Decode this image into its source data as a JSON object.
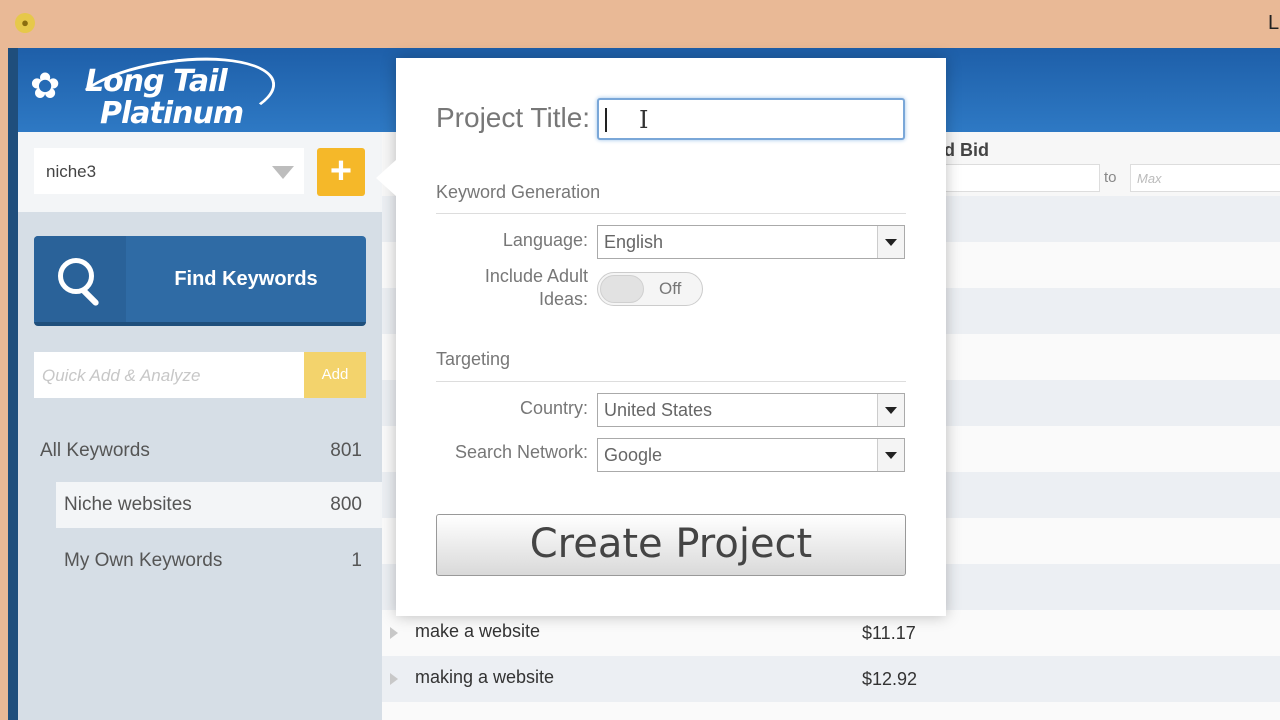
{
  "window": {
    "title_letter": "L",
    "app_icon": "app-icon"
  },
  "logo": {
    "line1": "Long Tail",
    "line2": "Platinum"
  },
  "sidebar": {
    "project_select": {
      "value": "niche3"
    },
    "add_project_icon": "+",
    "find_keywords_label": "Find Keywords",
    "quick_add": {
      "placeholder": "Quick Add & Analyze",
      "button_label": "Add"
    },
    "items": [
      {
        "label": "All Keywords",
        "count": "801"
      },
      {
        "label": "Niche websites",
        "count": "800"
      },
      {
        "label": "My Own Keywords",
        "count": "1"
      }
    ]
  },
  "table": {
    "bid_header": "d Bid",
    "range_to": "to",
    "range_max_placeholder": "Max",
    "rows": [
      {
        "keyword": "make a website",
        "bid": "$11.17"
      },
      {
        "keyword": "making a website",
        "bid": "$12.92"
      }
    ]
  },
  "dialog": {
    "project_title_label": "Project Title:",
    "project_title_value": "",
    "keyword_generation_heading": "Keyword Generation",
    "language_label": "Language:",
    "language_value": "English",
    "include_adult_label_1": "Include Adult",
    "include_adult_label_2": "Ideas:",
    "include_adult_state": "Off",
    "targeting_heading": "Targeting",
    "country_label": "Country:",
    "country_value": "United States",
    "search_network_label": "Search Network:",
    "search_network_value": "Google",
    "create_button_label": "Create Project"
  },
  "colors": {
    "accent_blue": "#2f6ba5",
    "accent_yellow": "#f5b829"
  }
}
